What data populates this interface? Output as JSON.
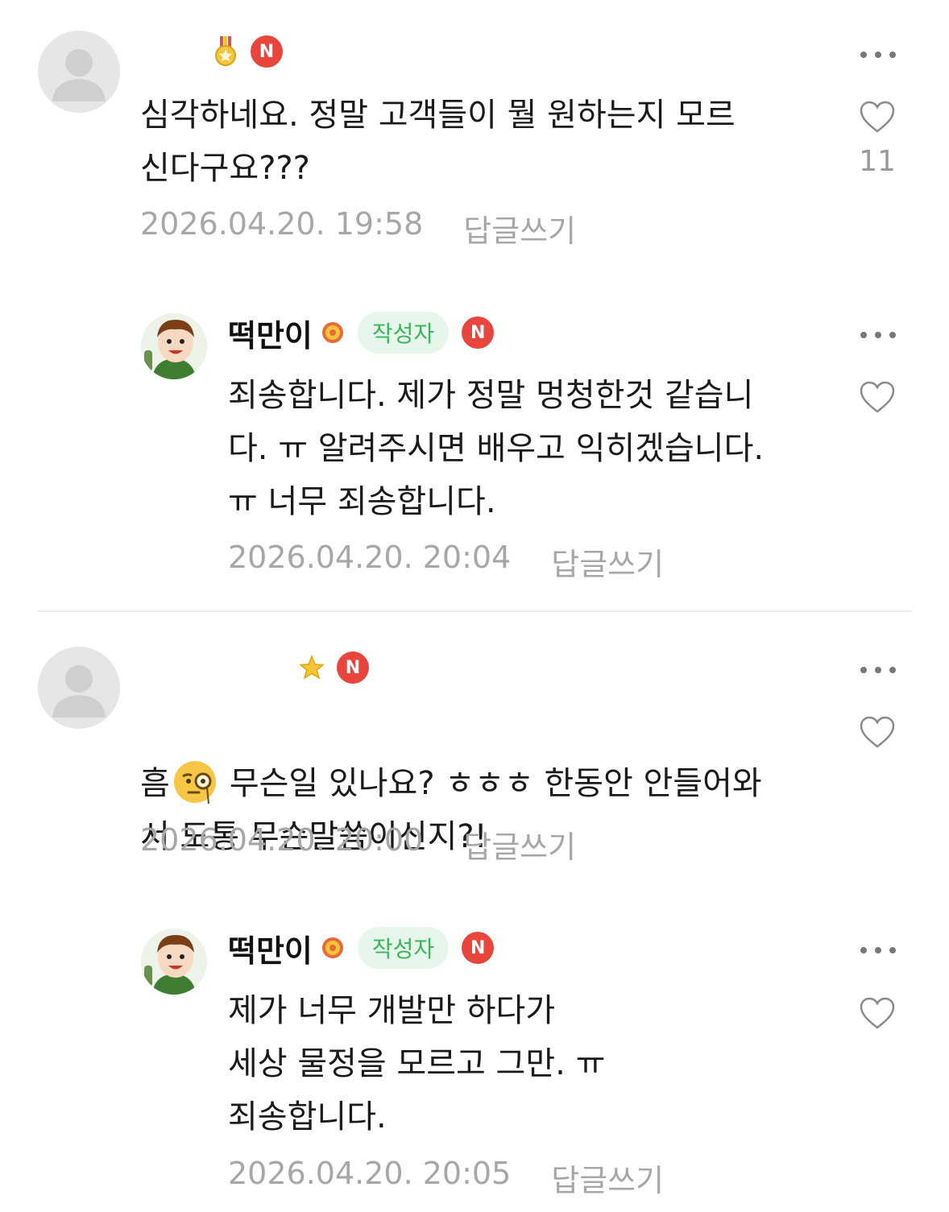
{
  "comments": [
    {
      "nickname": "",
      "badge_icon": "medal-icon",
      "n_badge": "N",
      "text": "심각하네요. 정말 고객들이 뭘 원하는지 모르\n신다구요???",
      "timestamp": "2026.04.20. 19:58",
      "reply_label": "답글쓰기",
      "like_count": "11"
    },
    {
      "nickname": "떡만이",
      "badge_icon": "sun-badge-icon",
      "writer_label": "작성자",
      "n_badge": "N",
      "text": "죄송합니다. 제가 정말 멍청한것 같습니\n다. ㅠ 알려주시면 배우고 익히겠습니다.\nㅠ 너무 죄송합니다.",
      "timestamp": "2026.04.20. 20:04",
      "reply_label": "답글쓰기"
    },
    {
      "nickname": "",
      "badge_icon": "star-icon",
      "n_badge": "N",
      "text_prefix": "흠",
      "emoji": "monocle-face-emoji",
      "text": "무슨일 있나요? ㅎㅎㅎ 한동안 안들어와\n서 도통 무슨말씀이신지?!",
      "timestamp": "2026.04.20. 20:00",
      "reply_label": "답글쓰기"
    },
    {
      "nickname": "떡만이",
      "badge_icon": "sun-badge-icon",
      "writer_label": "작성자",
      "n_badge": "N",
      "text": "제가 너무 개발만 하다가\n세상 물정을 모르고 그만. ㅠ\n죄송합니다.",
      "timestamp": "2026.04.20. 20:05",
      "reply_label": "답글쓰기"
    }
  ],
  "colors": {
    "writer_badge_bg": "#e6f6ea",
    "writer_badge_text": "#3bb55c",
    "n_badge": "#e8453c",
    "meta_text": "#a7a7a7"
  }
}
